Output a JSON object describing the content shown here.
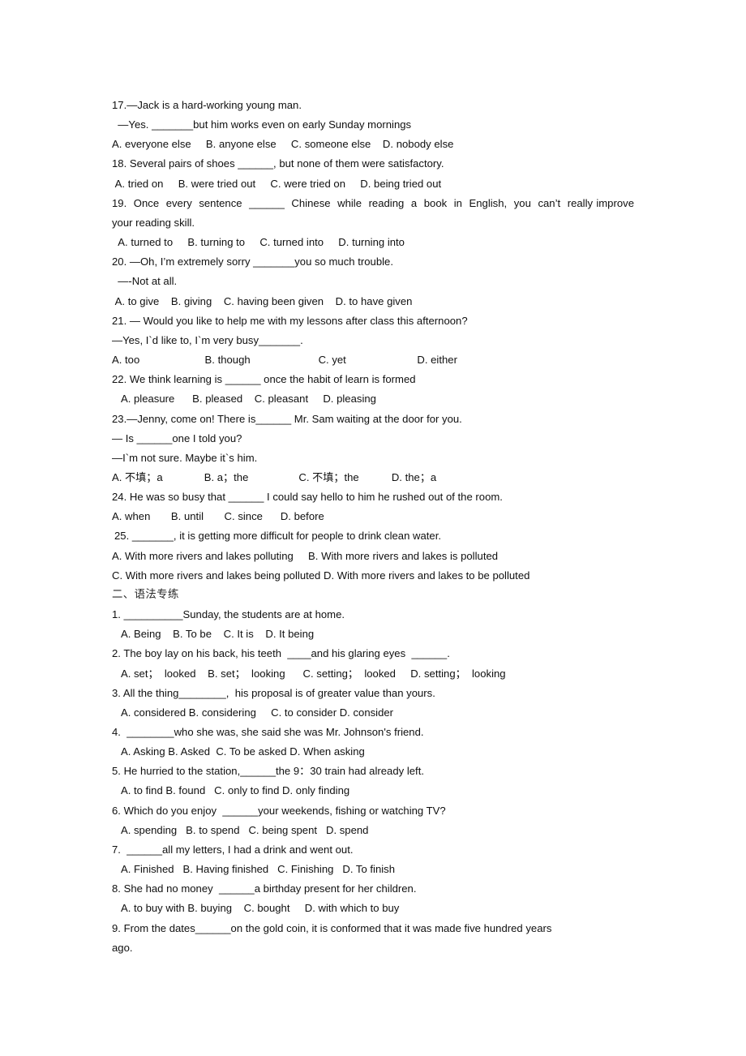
{
  "document": {
    "kind": "english-grammar-exercise-worksheet",
    "lines": [
      {
        "id": "q17-stem",
        "text": "17.—Jack is a hard-working young man.",
        "indent": 0,
        "style": "plain"
      },
      {
        "id": "q17-reply",
        "text": "  —Yes. _______but him works even on early Sunday mornings",
        "indent": 0,
        "style": "plain"
      },
      {
        "id": "q17-options",
        "text": "A. everyone else     B. anyone else     C. someone else    D. nobody else",
        "indent": 0,
        "style": "plain"
      },
      {
        "id": "q18-stem",
        "text": "18. Several pairs of shoes ______, but none of them were satisfactory.",
        "indent": 0,
        "style": "plain"
      },
      {
        "id": "q18-options",
        "text": " A. tried on     B. were tried out     C. were tried on     D. being tried out",
        "indent": 0,
        "style": "plain"
      },
      {
        "id": "q19-stem",
        "text": "19.  Once  every  sentence  ______  Chinese  while  reading  a  book  in  English,  you  can’t  really improve your reading skill.",
        "indent": 0,
        "style": "justify"
      },
      {
        "id": "q19-options",
        "text": "  A. turned to     B. turning to     C. turned into     D. turning into",
        "indent": 0,
        "style": "plain"
      },
      {
        "id": "q20-stem",
        "text": "20. —Oh, I’m extremely sorry _______you so much trouble.",
        "indent": 0,
        "style": "plain"
      },
      {
        "id": "q20-reply",
        "text": "  —-Not at all.",
        "indent": 0,
        "style": "plain"
      },
      {
        "id": "q20-options",
        "text": " A. to give    B. giving    C. having been given    D. to have given",
        "indent": 0,
        "style": "plain"
      },
      {
        "id": "q21-stem",
        "text": "21. — Would you like to help me with my lessons after class this afternoon?",
        "indent": 0,
        "style": "plain"
      },
      {
        "id": "q21-reply",
        "text": "—Yes, I`d like to, I`m very busy_______.",
        "indent": 0,
        "style": "plain"
      },
      {
        "id": "q21-options",
        "text": "A. too                      B. though                       C. yet                        D. either",
        "indent": 0,
        "style": "plain"
      },
      {
        "id": "q22-stem",
        "text": "22. We think learning is ______ once the habit of learn is formed",
        "indent": 0,
        "style": "plain"
      },
      {
        "id": "q22-options",
        "text": "   A. pleasure      B. pleased    C. pleasant     D. pleasing",
        "indent": 0,
        "style": "plain"
      },
      {
        "id": "q23-stem",
        "text": "23.—Jenny, come on! There is______ Mr. Sam waiting at the door for you.",
        "indent": 0,
        "style": "plain"
      },
      {
        "id": "q23-line2",
        "text": "— Is ______one I told you?",
        "indent": 0,
        "style": "plain"
      },
      {
        "id": "q23-line3",
        "text": "—I`m not sure. Maybe it`s him.",
        "indent": 0,
        "style": "plain"
      },
      {
        "id": "q23-options",
        "text": "A. 不填；a              B. a；the                 C. 不填；the           D. the；a",
        "indent": 0,
        "style": "plain"
      },
      {
        "id": "q24-stem",
        "text": "24. He was so busy that ______ I could say hello to him he rushed out of the room.",
        "indent": 0,
        "style": "plain"
      },
      {
        "id": "q24-options",
        "text": "A. when       B. until       C. since      D. before",
        "indent": 0,
        "style": "plain"
      },
      {
        "id": "q25-stem",
        "text": "25. _______, it is getting more difficult for people to drink clean water.",
        "indent": 0,
        "style": "plain"
      },
      {
        "id": "q25-optionsAB",
        "text": "A. With more rivers and lakes polluting     B. With more rivers and lakes is polluted",
        "indent": 0,
        "style": "plain"
      },
      {
        "id": "q25-optionsCD",
        "text": "C. With more rivers and lakes being polluted D. With more rivers and lakes to be polluted",
        "indent": 0,
        "style": "plain"
      },
      {
        "id": "section-two",
        "text": "二、语法专练",
        "indent": 0,
        "style": "cn-head"
      },
      {
        "id": "g1-stem",
        "text": "1. __________Sunday, the students are at home.",
        "indent": 0,
        "style": "plain"
      },
      {
        "id": "g1-options",
        "text": "   A. Being    B. To be    C. It is    D. It being",
        "indent": 0,
        "style": "plain"
      },
      {
        "id": "g2-stem",
        "text": "2. The boy lay on his back, his teeth  ____and his glaring eyes  ______.",
        "indent": 0,
        "style": "plain"
      },
      {
        "id": "g2-options",
        "text": "   A. set；  looked    B. set；  looking      C. setting；  looked     D. setting；  looking",
        "indent": 0,
        "style": "plain"
      },
      {
        "id": "g3-stem",
        "text": "3. All the thing________,  his proposal is of greater value than yours.",
        "indent": 0,
        "style": "plain"
      },
      {
        "id": "g3-options",
        "text": "   A. considered B. considering     C. to consider D. consider",
        "indent": 0,
        "style": "plain"
      },
      {
        "id": "g4-stem",
        "text": "4.  ________who she was, she said she was Mr. Johnson's friend.",
        "indent": 0,
        "style": "plain"
      },
      {
        "id": "g4-options",
        "text": "   A. Asking B. Asked  C. To be asked D. When asking",
        "indent": 0,
        "style": "plain"
      },
      {
        "id": "g5-stem",
        "text": "5. He hurried to the station,______the 9：30 train had already left.",
        "indent": 0,
        "style": "plain"
      },
      {
        "id": "g5-options",
        "text": "   A. to find B. found   C. only to find D. only finding",
        "indent": 0,
        "style": "plain"
      },
      {
        "id": "g6-stem",
        "text": "6. Which do you enjoy  ______your weekends, fishing or watching TV?",
        "indent": 0,
        "style": "plain"
      },
      {
        "id": "g6-options",
        "text": "   A. spending   B. to spend   C. being spent   D. spend",
        "indent": 0,
        "style": "plain"
      },
      {
        "id": "g7-stem",
        "text": "7.  ______all my letters, I had a drink and went out.",
        "indent": 0,
        "style": "plain"
      },
      {
        "id": "g7-options",
        "text": "   A. Finished   B. Having finished   C. Finishing   D. To finish",
        "indent": 0,
        "style": "plain"
      },
      {
        "id": "g8-stem",
        "text": "8. She had no money  ______a birthday present for her children.",
        "indent": 0,
        "style": "plain"
      },
      {
        "id": "g8-options",
        "text": "   A. to buy with B. buying    C. bought     D. with which to buy",
        "indent": 0,
        "style": "plain"
      },
      {
        "id": "g9-stem",
        "text": "9. From the dates______on the gold coin, it is conformed that it was made five hundred years",
        "indent": 0,
        "style": "plain"
      },
      {
        "id": "g9-cont",
        "text": "ago.",
        "indent": 0,
        "style": "plain"
      }
    ]
  }
}
